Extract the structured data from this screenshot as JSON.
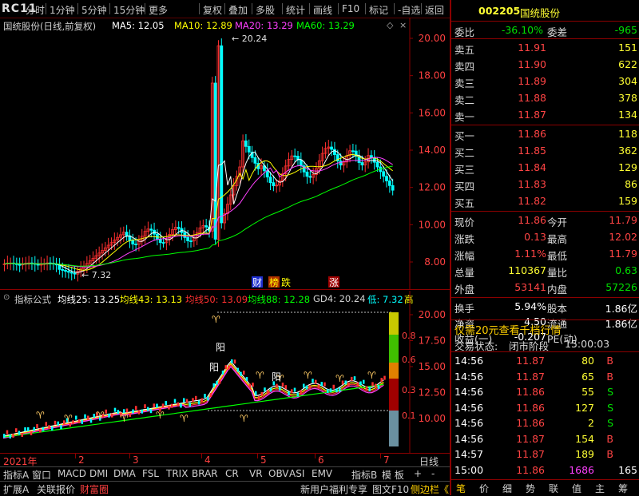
{
  "menu": {
    "logo": "RC11",
    "items": [
      "分时",
      "1分钟",
      "5分钟",
      "15分钟",
      "更多",
      "复权",
      "叠加",
      "多股",
      "统计",
      "画线",
      "F10",
      "标记",
      "-自选",
      "返回"
    ]
  },
  "main_chart": {
    "title": "国统股份(日线,前复权)",
    "ma": [
      {
        "label": "MA5: 12.05",
        "color": "#ffffff"
      },
      {
        "label": "MA10: 12.89",
        "color": "#ffff00"
      },
      {
        "label": "MA20: 13.29",
        "color": "#ff40ff"
      },
      {
        "label": "MA60: 13.29",
        "color": "#00ff00"
      }
    ],
    "y_ticks": [
      "20.00",
      "18.00",
      "16.00",
      "14.00",
      "12.00",
      "10.00",
      "8.00"
    ],
    "high_label": "20.24",
    "low_label": "7.32",
    "markers": [
      "财",
      "榜",
      "跌",
      "涨"
    ]
  },
  "lower_chart": {
    "title": "指标公式",
    "items": [
      {
        "label": "均线25: 13.25",
        "color": "#ffffff"
      },
      {
        "label": "均线43: 13.13",
        "color": "#ffff00"
      },
      {
        "label": "均线50: 13.09",
        "color": "#ff3030"
      },
      {
        "label": "均线88: 12.28",
        "color": "#00ff00"
      },
      {
        "label": "GD4: 20.24",
        "color": "#d0d0d0"
      },
      {
        "label": "低: 7.32",
        "color": "#00ffff"
      },
      {
        "label": "高",
        "color": "#ffff00"
      }
    ],
    "y_ticks": [
      "20.00",
      "17.50",
      "15.00",
      "12.50",
      "10.00"
    ],
    "bar_ticks": [
      "0.8",
      "0.6",
      "0.3",
      "0.1"
    ],
    "text_marks": [
      "阳",
      "阳",
      "阳"
    ]
  },
  "x_axis": {
    "labels": [
      "2021年",
      "2",
      "3",
      "4",
      "5",
      "6",
      "7"
    ],
    "right_label": "日线"
  },
  "tabs": [
    "指标A",
    "窗口",
    "MACD",
    "DMI",
    "DMA",
    "FSL",
    "TRIX",
    "BRAR",
    "CR",
    "VR",
    "OBV",
    "ASI",
    "EMV",
    "指标B",
    "模 板",
    "+",
    "-"
  ],
  "status": [
    "扩展A",
    "关联报价",
    "财富圈"
  ],
  "right_panel": {
    "code": "002205",
    "name": "国统股份",
    "webi_label": "委比",
    "webi_value": "-36.10%",
    "weicha_label": "委差",
    "weicha_value": "-965",
    "sells": [
      {
        "label": "卖五",
        "price": "11.91",
        "vol": "151"
      },
      {
        "label": "卖四",
        "price": "11.90",
        "vol": "622"
      },
      {
        "label": "卖三",
        "price": "11.89",
        "vol": "304"
      },
      {
        "label": "卖二",
        "price": "11.88",
        "vol": "378"
      },
      {
        "label": "卖一",
        "price": "11.87",
        "vol": "134"
      }
    ],
    "buys": [
      {
        "label": "买一",
        "price": "11.86",
        "vol": "118"
      },
      {
        "label": "买二",
        "price": "11.85",
        "vol": "362"
      },
      {
        "label": "买三",
        "price": "11.84",
        "vol": "129"
      },
      {
        "label": "买四",
        "price": "11.83",
        "vol": "86"
      },
      {
        "label": "买五",
        "price": "11.82",
        "vol": "159"
      }
    ],
    "quote": [
      {
        "l1": "现价",
        "v1": "11.86",
        "c1": "red",
        "l2": "今开",
        "v2": "11.79",
        "c2": "red"
      },
      {
        "l1": "涨跌",
        "v1": "0.13",
        "c1": "red",
        "l2": "最高",
        "v2": "12.02",
        "c2": "red"
      },
      {
        "l1": "涨幅",
        "v1": "1.11%",
        "c1": "red",
        "l2": "最低",
        "v2": "11.79",
        "c2": "red"
      },
      {
        "l1": "总量",
        "v1": "110367",
        "c1": "yel",
        "l2": "量比",
        "v2": "0.63",
        "c2": "grn"
      },
      {
        "l1": "外盘",
        "v1": "53141",
        "c1": "red",
        "l2": "内盘",
        "v2": "57226",
        "c2": "grn"
      }
    ],
    "stats": [
      {
        "l1": "换手",
        "v1": "5.94%",
        "l2": "股本",
        "v2": "1.86亿"
      },
      {
        "l1": "净资",
        "v1": "4.50",
        "l2": "流通",
        "v2": "1.86亿"
      },
      {
        "l1": "收益(一)",
        "v1": "-0.207",
        "l2": "PE(动)",
        "v2": ""
      }
    ],
    "promo": "仅需20元查看千档行情",
    "trade_state_label": "交易状态:",
    "trade_state": "闭市阶段",
    "trade_time": "15:00:03",
    "ticks": [
      {
        "t": "14:56",
        "p": "11.87",
        "v": "80",
        "s": "B"
      },
      {
        "t": "14:56",
        "p": "11.87",
        "v": "65",
        "s": "B"
      },
      {
        "t": "14:56",
        "p": "11.86",
        "v": "55",
        "s": "S"
      },
      {
        "t": "14:56",
        "p": "11.86",
        "v": "127",
        "s": "S"
      },
      {
        "t": "14:56",
        "p": "11.86",
        "v": "2",
        "s": "S"
      },
      {
        "t": "14:56",
        "p": "11.87",
        "v": "154",
        "s": "B"
      },
      {
        "t": "14:57",
        "p": "11.87",
        "v": "189",
        "s": "B"
      },
      {
        "t": "15:00",
        "p": "11.86",
        "v": "1686",
        "s": "165"
      }
    ],
    "bottom_tabs": [
      "新用户福利专享",
      "图文F10",
      "侧边栏《",
      "笔",
      "价",
      "细",
      "势",
      "联",
      "值",
      "主",
      "筹"
    ]
  }
}
